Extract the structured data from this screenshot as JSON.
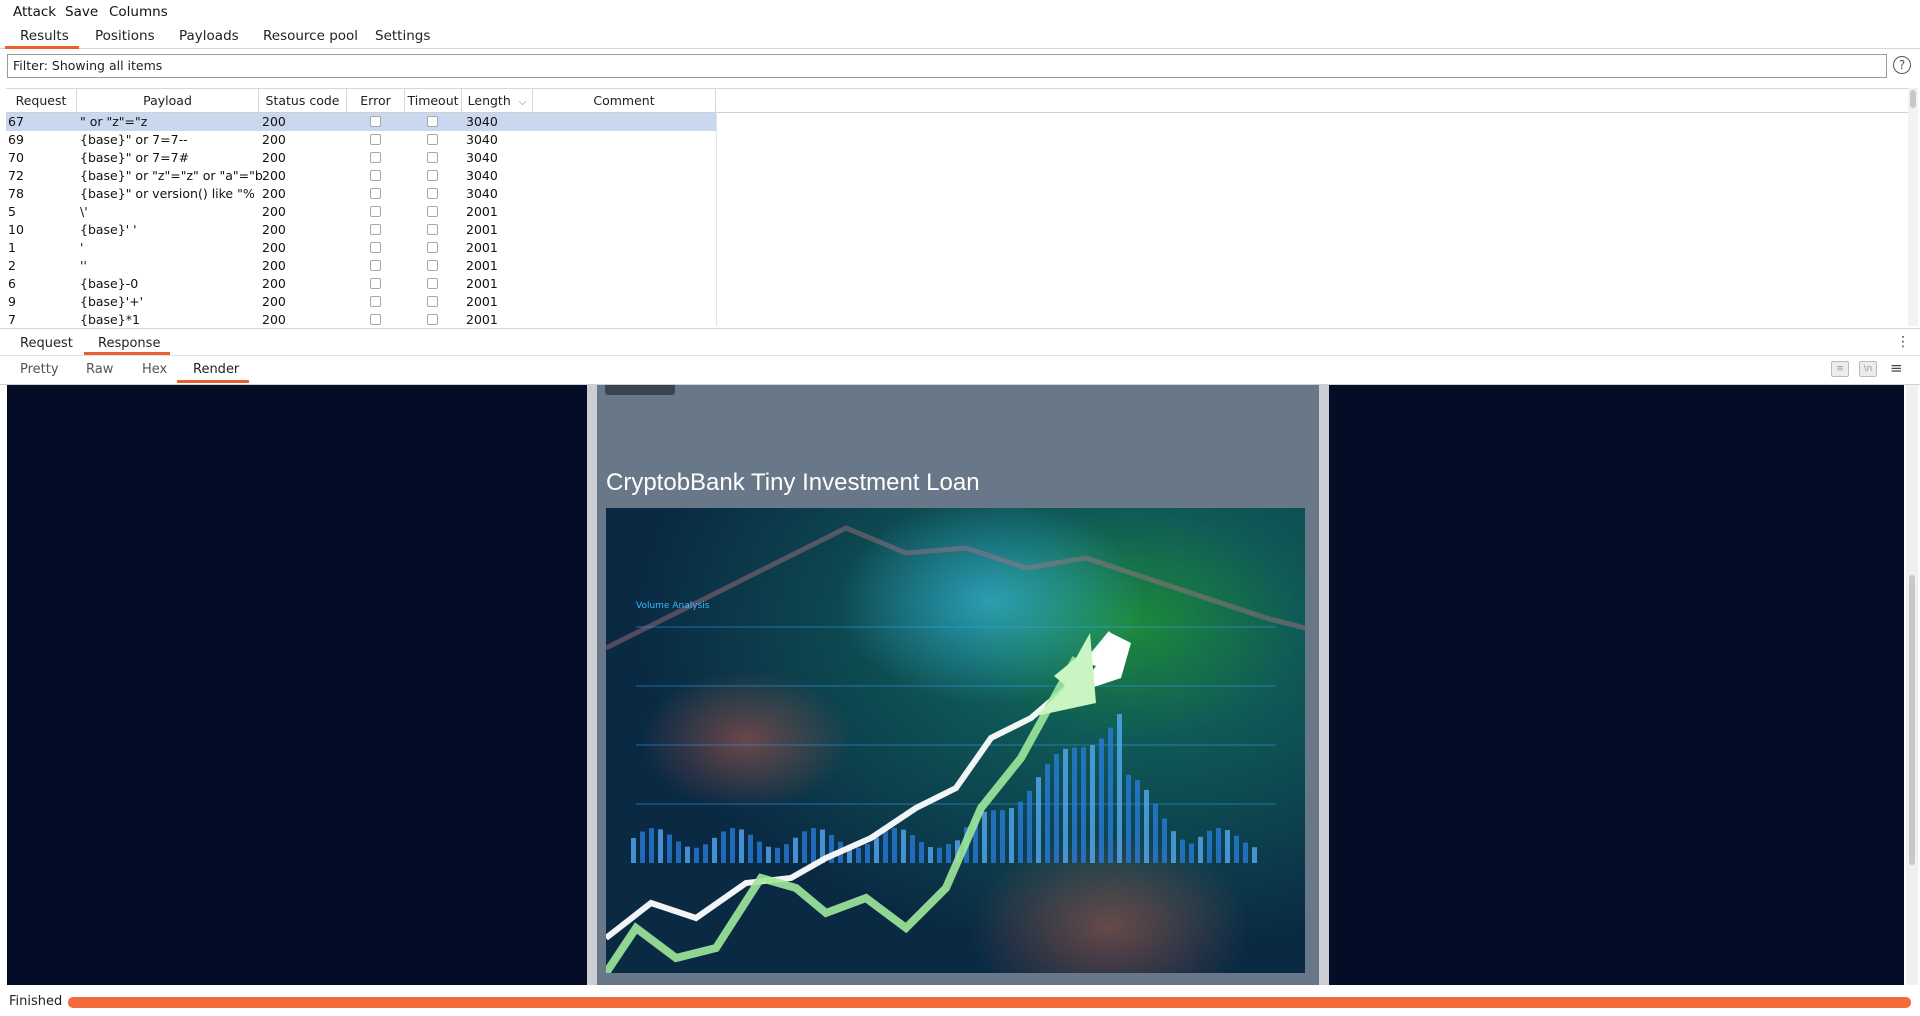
{
  "menu": {
    "items": [
      "Attack",
      "Save",
      "Columns"
    ]
  },
  "top_tabs": {
    "items": [
      "Results",
      "Positions",
      "Payloads",
      "Resource pool",
      "Settings"
    ],
    "active": "Results"
  },
  "filter": {
    "text": "Filter: Showing all items"
  },
  "table": {
    "headers": {
      "request": "Request",
      "payload": "Payload",
      "status": "Status code",
      "error": "Error",
      "timeout": "Timeout",
      "length": "Length",
      "comment": "Comment"
    },
    "sort_indicator": "⌵",
    "rows": [
      {
        "request": "67",
        "payload": "\" or \"z\"=\"z",
        "status": "200",
        "length": "3040",
        "selected": true
      },
      {
        "request": "69",
        "payload": "{base}\" or 7=7--",
        "status": "200",
        "length": "3040"
      },
      {
        "request": "70",
        "payload": "{base}\" or 7=7#",
        "status": "200",
        "length": "3040"
      },
      {
        "request": "72",
        "payload": "{base}\" or \"z\"=\"z\" or \"a\"=\"b",
        "status": "200",
        "length": "3040"
      },
      {
        "request": "78",
        "payload": "{base}\" or version() like \"%",
        "status": "200",
        "length": "3040"
      },
      {
        "request": "5",
        "payload": "\\'",
        "status": "200",
        "length": "2001"
      },
      {
        "request": "10",
        "payload": "{base}' '",
        "status": "200",
        "length": "2001"
      },
      {
        "request": "1",
        "payload": "'",
        "status": "200",
        "length": "2001"
      },
      {
        "request": "2",
        "payload": "''",
        "status": "200",
        "length": "2001"
      },
      {
        "request": "6",
        "payload": "{base}-0",
        "status": "200",
        "length": "2001"
      },
      {
        "request": "9",
        "payload": "{base}'+'",
        "status": "200",
        "length": "2001"
      },
      {
        "request": "7",
        "payload": "{base}*1",
        "status": "200",
        "length": "2001"
      }
    ]
  },
  "message_tabs": {
    "items": [
      "Request",
      "Response"
    ],
    "active": "Response"
  },
  "view_tabs": {
    "items": [
      "Pretty",
      "Raw",
      "Hex",
      "Render"
    ],
    "active": "Render"
  },
  "view_icons": {
    "wrap": "wrap-lines-icon",
    "newline": "show-newlines-icon",
    "menu": "menu-icon",
    "newline_glyph": "\\n"
  },
  "render": {
    "title": "CryptobBank Tiny Investment Loan",
    "image_caption": "Volume Analysis",
    "colors": {
      "background": "#040c26",
      "card": "#687888",
      "accent": "#e8612c"
    }
  },
  "status": {
    "text": "Finished",
    "progress": 1.0
  }
}
